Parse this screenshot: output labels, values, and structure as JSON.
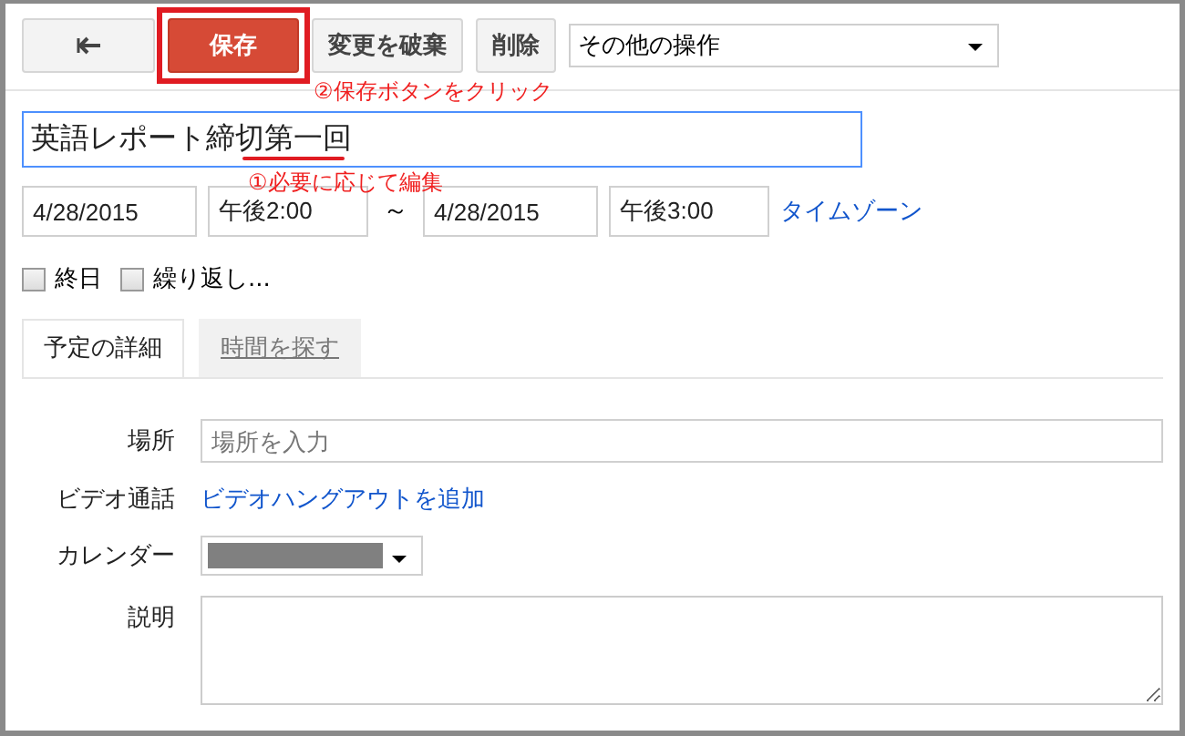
{
  "toolbar": {
    "save": "保存",
    "discard": "変更を破棄",
    "delete": "削除",
    "more_actions": "その他の操作"
  },
  "title_field": {
    "value": "英語レポート締切第一回"
  },
  "when": {
    "start_date": "4/28/2015",
    "start_time": "午後2:00",
    "separator": "～",
    "end_date": "4/28/2015",
    "end_time": "午後3:00",
    "timezone_link": "タイムゾーン"
  },
  "options": [
    {
      "label": "終日",
      "checked": false
    },
    {
      "label": "繰り返し...",
      "checked": false
    }
  ],
  "tabs": [
    {
      "label": "予定の詳細",
      "selected": true
    },
    {
      "label": "時間を探す",
      "selected": false
    }
  ],
  "details": {
    "location_label": "場所",
    "location_placeholder": "場所を入力",
    "video_label": "ビデオ通話",
    "video_link": "ビデオハングアウトを追加",
    "calendar_label": "カレンダー",
    "description_label": "説明"
  },
  "annotations": [
    {
      "kind": "save",
      "text": "②保存ボタンをクリック"
    },
    {
      "kind": "title",
      "text": "①必要に応じて編集"
    }
  ]
}
